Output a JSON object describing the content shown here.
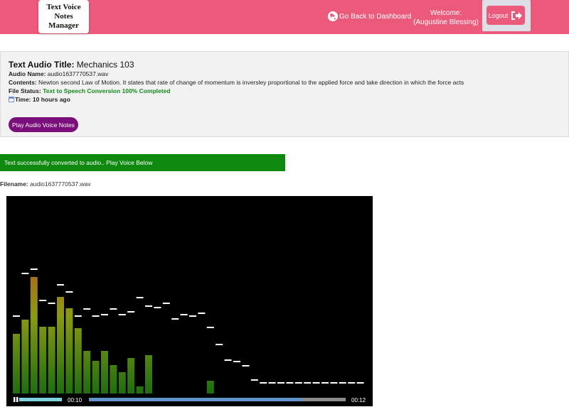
{
  "navbar": {
    "brand": "Text Voice Notes Manager",
    "back_link": "Go Back to Dashboard",
    "welcome_label": "Welcome:",
    "user_name": "(Augustine Blessing)",
    "logout_label": "Logout"
  },
  "note": {
    "title_label": "Text Audio Title:",
    "title_value": "Mechanics 103",
    "audio_name_label": "Audio Name:",
    "audio_name_value": "audio1637770537.wav",
    "contents_label": "Contents:",
    "contents_value": "Newton second Law of Motion. It states that rate of change of momentum is inversley proportional to the applied force and take direction in which the force acts",
    "file_status_label": "File Status:",
    "file_status_value": "Text to Speech Conversion 100% Completed",
    "time_label": "Time:",
    "time_value": "10 hours ago",
    "play_button": "Play Audio Voice Notes"
  },
  "alert": {
    "message": "Text successfully converted to audio.. Play Voice Below"
  },
  "file": {
    "label": "Filename:",
    "value": "audio1637770537.wav"
  },
  "player": {
    "current_time": "00:10",
    "duration": "00:12",
    "progress": 0.83,
    "volume": 1.0,
    "spectrum_bars": [
      0.42,
      0.52,
      0.82,
      0.47,
      0.47,
      0.68,
      0.6,
      0.46,
      0.3,
      0.23,
      0.3,
      0.2,
      0.15,
      0.25,
      0.05,
      0.27,
      0,
      0,
      0,
      0,
      0,
      0,
      0.09,
      0,
      0,
      0,
      0,
      0,
      0,
      0,
      0,
      0,
      0,
      0,
      0,
      0,
      0,
      0,
      0,
      0,
      0
    ],
    "spectrum_peaks": [
      0.55,
      0.85,
      0.88,
      0.66,
      0.64,
      0.77,
      0.72,
      0.55,
      0.6,
      0.55,
      0.56,
      0.6,
      0.56,
      0.58,
      0.68,
      0.62,
      0.61,
      0.64,
      0.53,
      0.56,
      0.55,
      0.57,
      0.47,
      0.35,
      0.24,
      0.23,
      0.2,
      0.1,
      0.08,
      0.08,
      0.08,
      0.08,
      0.08,
      0.08,
      0.08,
      0.08,
      0.08,
      0.08,
      0.08,
      0.08
    ]
  }
}
